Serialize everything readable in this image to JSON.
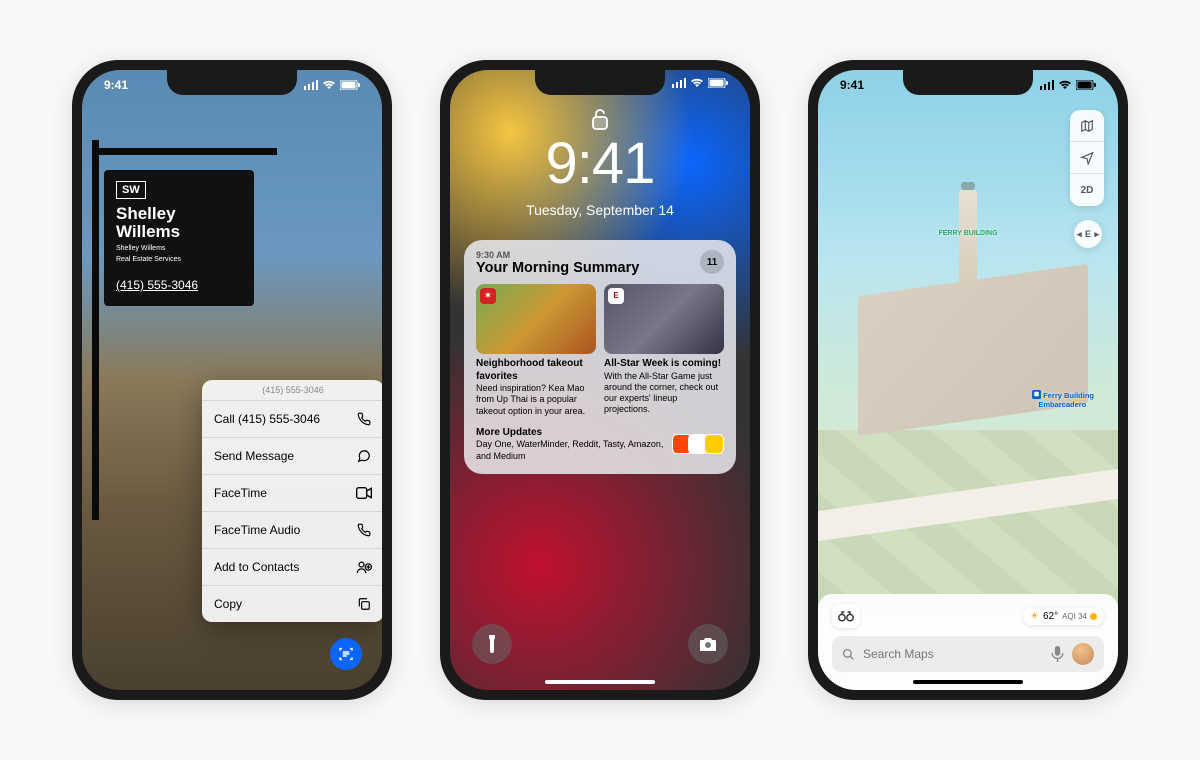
{
  "status": {
    "time": "9:41",
    "signal": "●●●●",
    "wifi": "wifi",
    "battery": "100"
  },
  "phone1": {
    "sign": {
      "logo": "SW",
      "name_line1": "Shelley",
      "name_line2": "Willems",
      "sub_line1": "Shelley Willems",
      "sub_line2": "Real Estate Services",
      "phone": "(415) 555-3046"
    },
    "menu": {
      "header": "(415) 555-3046",
      "items": [
        {
          "label": "Call (415) 555-3046",
          "icon": "phone"
        },
        {
          "label": "Send Message",
          "icon": "message"
        },
        {
          "label": "FaceTime",
          "icon": "video"
        },
        {
          "label": "FaceTime Audio",
          "icon": "phone"
        },
        {
          "label": "Add to Contacts",
          "icon": "contact"
        },
        {
          "label": "Copy",
          "icon": "copy"
        }
      ]
    }
  },
  "phone2": {
    "lock_time": "9:41",
    "lock_date": "Tuesday, September 14",
    "summary": {
      "time": "9:30 AM",
      "title": "Your Morning Summary",
      "count": "11",
      "tiles": [
        {
          "badge_bg": "#d32323",
          "title": "Neighborhood takeout favorites",
          "body": "Need inspiration? Kea Mao from Up Thai is a popular takeout option in your area."
        },
        {
          "badge_bg": "#ffffff",
          "title": "All-Star Week is coming!",
          "body": "With the All-Star Game just around the corner, check out our experts' lineup projections."
        }
      ],
      "more_title": "More Updates",
      "more_body": "Day One, WaterMinder, Reddit, Tasty, Amazon, and Medium",
      "more_icons": [
        "#ff4500",
        "#fff",
        "#ffcc00"
      ]
    }
  },
  "phone3": {
    "controls": {
      "mode_2d": "2D"
    },
    "compass": "E",
    "poi": "FERRY BUILDING",
    "transit_1": "Ferry Building",
    "transit_2": "Embarcadero",
    "weather": {
      "icon": "☀︎",
      "temp": "62°",
      "aqi_label": "AQI 34"
    },
    "search_placeholder": "Search Maps"
  }
}
